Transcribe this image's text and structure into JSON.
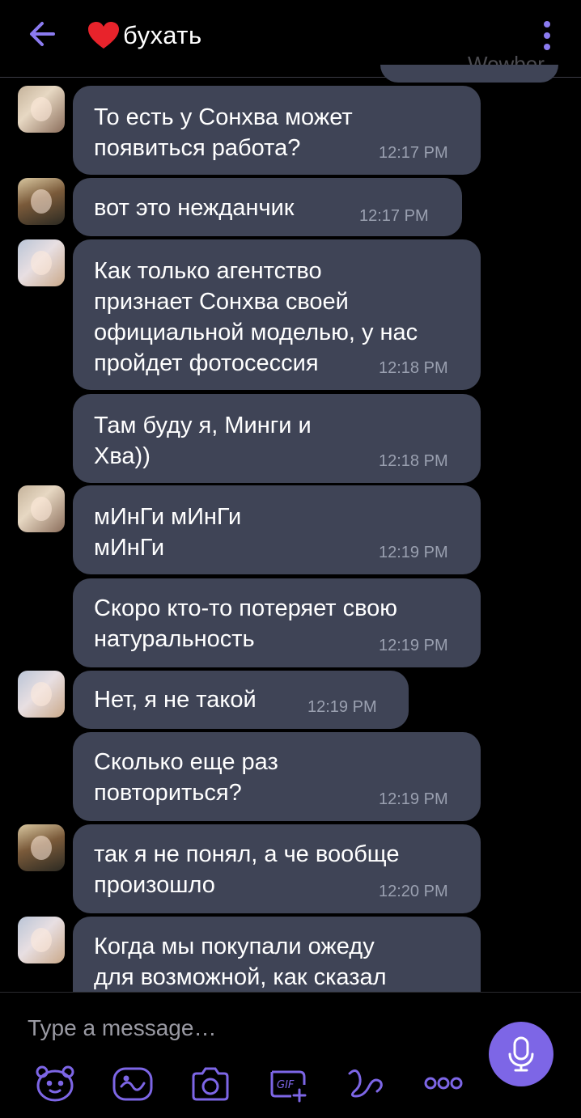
{
  "header": {
    "title": "бухать",
    "watermark": "Wowber",
    "accent": "#7d66e6"
  },
  "messages": [
    {
      "sender": "user-a",
      "lines": "То есть у Сонхва может\nпоявиться работа?",
      "time": "12:17 PM"
    },
    {
      "sender": "user-b",
      "lines": "вот это нежданчик",
      "time": "12:17 PM"
    },
    {
      "sender": "user-c",
      "lines": "Как только агентство\nпризнает Сонхва своей\nофициальной моделью, у нас\nпройдет фотосессия",
      "time": "12:18 PM"
    },
    {
      "sender": "user-c",
      "lines": "Там буду я, Минги и\nХва))",
      "time": "12:18 PM"
    },
    {
      "sender": "user-a",
      "lines": "мИнГи мИнГи\nмИнГи",
      "time": "12:19 PM"
    },
    {
      "sender": "user-a",
      "lines": "Скоро кто-то потеряет свою\nнатуральность",
      "time": "12:19 PM"
    },
    {
      "sender": "user-c",
      "lines": "Нет, я не такой",
      "time": "12:19 PM"
    },
    {
      "sender": "user-c",
      "lines": "Сколько еще раз\nповториться?",
      "time": "12:19 PM"
    },
    {
      "sender": "user-b",
      "lines": "так я не понял, а че вообще\nпроизошло",
      "time": "12:20 PM"
    },
    {
      "sender": "user-c",
      "lines": "Когда мы покупали ожеду\nдля возможной, как сказал",
      "time": ""
    }
  ],
  "composer": {
    "placeholder": "Type a message…",
    "toolbar_icons": [
      "sticker-bear-icon",
      "doodle-icon",
      "camera-icon",
      "gif-icon",
      "scribble-icon",
      "more-dots-icon"
    ],
    "mic_icon": "microphone-icon"
  }
}
